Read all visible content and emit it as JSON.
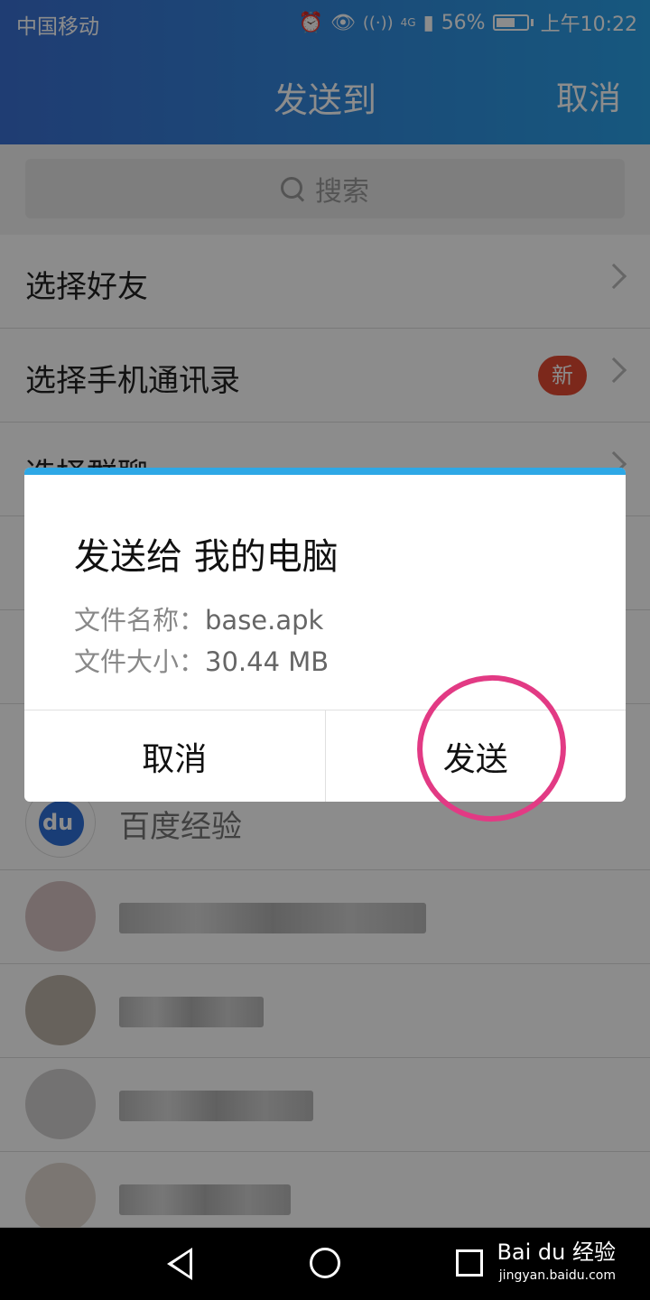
{
  "status_bar": {
    "carrier": "中国移动",
    "network": "4G",
    "battery": "56%",
    "time": "上午10:22"
  },
  "header": {
    "title": "发送到",
    "cancel": "取消"
  },
  "search": {
    "placeholder": "搜索"
  },
  "menu": [
    {
      "label": "选择好友"
    },
    {
      "label": "选择手机通讯录",
      "badge": "新"
    },
    {
      "label": "选择群聊"
    }
  ],
  "contacts": [
    {
      "name": "百度经验"
    }
  ],
  "dialog": {
    "title": "发送给 我的电脑",
    "file_name_label": "文件名称：",
    "file_name": "base.apk",
    "file_size_label": "文件大小：",
    "file_size": "30.44 MB",
    "cancel": "取消",
    "send": "发送"
  },
  "watermark": {
    "brand": "Bai du 经验",
    "url": "jingyan.baidu.com"
  }
}
